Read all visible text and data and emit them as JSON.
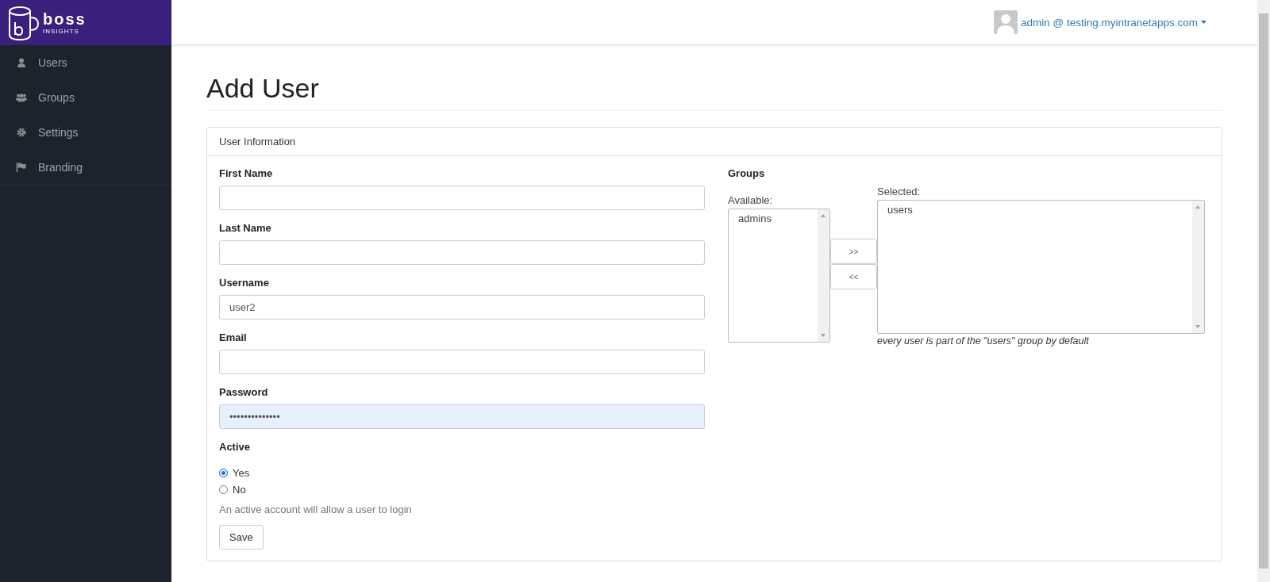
{
  "logo": {
    "name": "boss",
    "tagline": "INSIGHTS"
  },
  "sidebar": {
    "items": [
      {
        "label": "Users",
        "selected": false
      },
      {
        "label": "Groups",
        "selected": false
      },
      {
        "label": "Settings",
        "selected": false
      },
      {
        "label": "Branding",
        "selected": false
      }
    ]
  },
  "account": {
    "label": "admin @ testing.myintranetapps.com"
  },
  "page_title": "Add User",
  "panel": {
    "title": "User Information",
    "fields": [
      {
        "label": "First Name",
        "autofilled": false
      },
      {
        "label": "Last Name",
        "autofilled": false
      },
      {
        "label": "Username",
        "value": "user2",
        "autofilled": false
      },
      {
        "label": "Email",
        "autofilled": false
      },
      {
        "label": "Password",
        "value": "••••••••••••••",
        "autofilled": true
      }
    ],
    "active": {
      "label": "Active",
      "options": [
        {
          "label": "Yes",
          "selected": true
        },
        {
          "label": "No",
          "selected": false
        }
      ],
      "help": "An active account will allow a user to login"
    },
    "save_button": "Save",
    "groups": {
      "title": "Groups",
      "available_label": "Available:",
      "available": [
        "admins"
      ],
      "add_button": ">>",
      "remove_button": "<<",
      "selected_label": "Selected:",
      "selected": [
        "users"
      ],
      "note": "every user is part of the \"users\" group by default"
    }
  }
}
